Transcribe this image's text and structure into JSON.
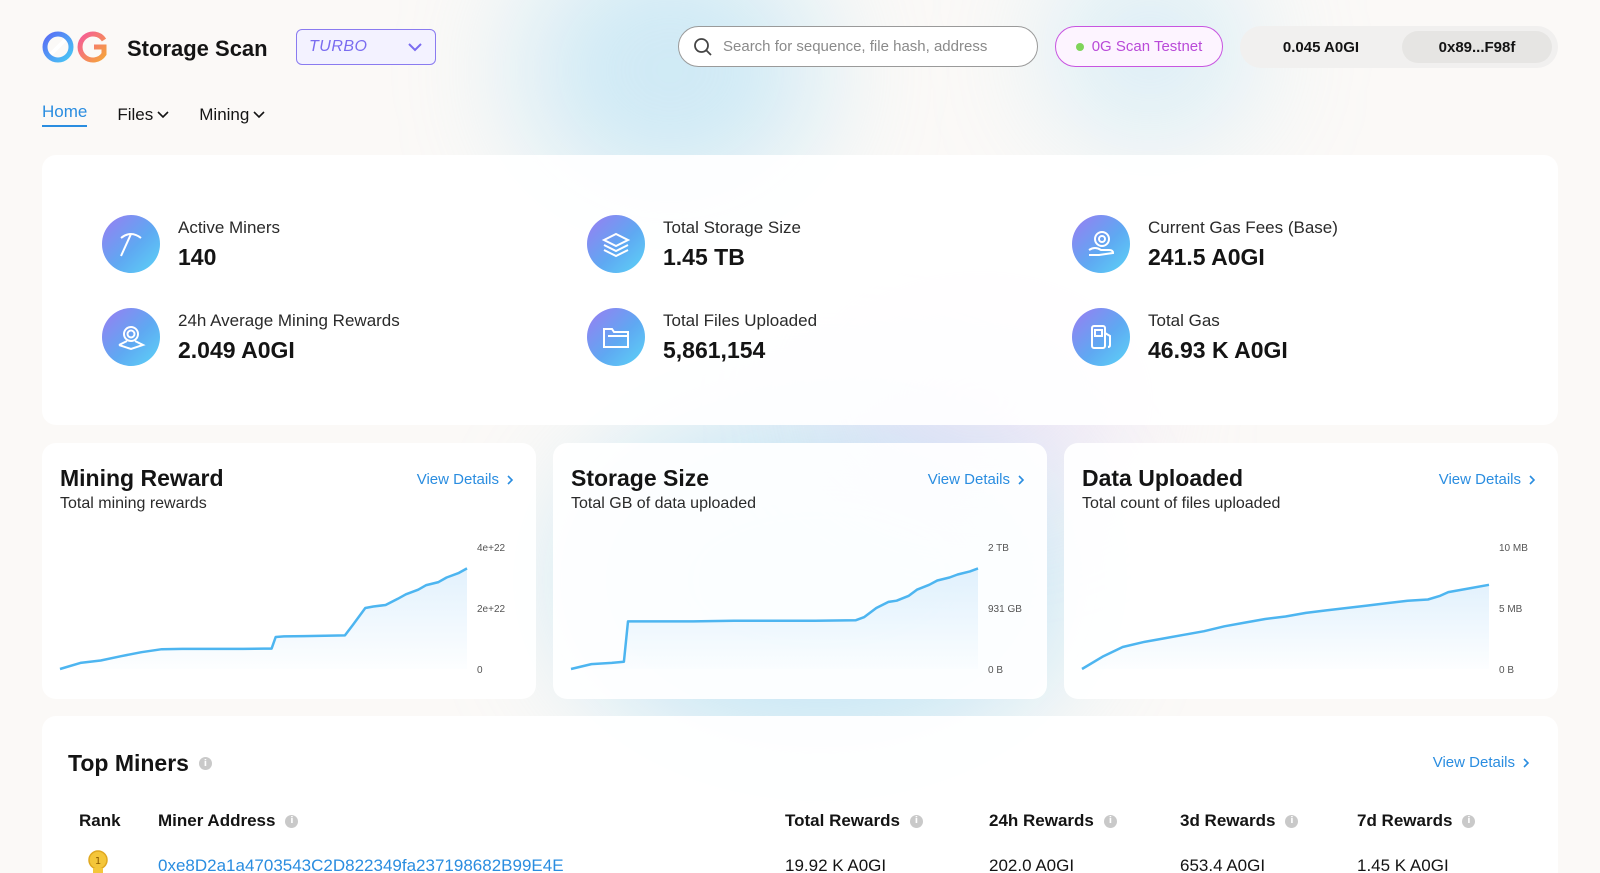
{
  "header": {
    "brand": "Storage Scan",
    "network_select": "TURBO",
    "search_placeholder": "Search for sequence, file hash, address",
    "testnet_label": "0G Scan Testnet",
    "wallet_balance": "0.045 A0GI",
    "wallet_address": "0x89...F98f"
  },
  "nav": {
    "items": [
      {
        "label": "Home"
      },
      {
        "label": "Files"
      },
      {
        "label": "Mining"
      }
    ]
  },
  "stats": [
    {
      "label": "Active Miners",
      "value": "140",
      "icon": "pickaxe-icon"
    },
    {
      "label": "Total Storage Size",
      "value": "1.45 TB",
      "icon": "layers-icon"
    },
    {
      "label": "Current Gas Fees (Base)",
      "value": "241.5 A0GI",
      "icon": "hand-coin-icon"
    },
    {
      "label": "24h Average Mining Rewards",
      "value": "2.049 A0GI",
      "icon": "coin-stack-icon"
    },
    {
      "label": "Total Files Uploaded",
      "value": "5,861,154",
      "icon": "folder-icon"
    },
    {
      "label": "Total Gas",
      "value": "46.93 K A0GI",
      "icon": "fuel-pump-icon"
    }
  ],
  "charts": [
    {
      "title": "Mining Reward",
      "subtitle": "Total mining rewards",
      "link": "View Details",
      "yticks": [
        "4e+22",
        "2e+22",
        "0"
      ]
    },
    {
      "title": "Storage Size",
      "subtitle": "Total GB of data uploaded",
      "link": "View Details",
      "yticks": [
        "2 TB",
        "931 GB",
        "0 B"
      ]
    },
    {
      "title": "Data Uploaded",
      "subtitle": "Total count of files uploaded",
      "link": "View Details",
      "yticks": [
        "10 MB",
        "5 MB",
        "0 B"
      ]
    }
  ],
  "chart_data": [
    {
      "type": "area",
      "title": "Mining Reward",
      "subtitle": "Total mining rewards",
      "ylim": [
        0,
        4e+22
      ],
      "x": [
        0,
        5,
        10,
        15,
        20,
        25,
        30,
        35,
        40,
        45,
        50,
        52,
        53,
        55,
        60,
        65,
        70,
        72,
        75,
        77,
        80,
        83,
        85,
        88,
        90,
        93,
        95,
        98,
        100
      ],
      "series": [
        {
          "values": [
            0,
            2e+21,
            2.8e+21,
            4.2e+21,
            5.5e+21,
            6.5e+21,
            6.6e+21,
            6.6e+21,
            6.6e+21,
            6.6e+21,
            6.7e+21,
            6.7e+21,
            1.05e+22,
            1.07e+22,
            1.08e+22,
            1.09e+22,
            1.1e+22,
            1.45e+22,
            2e+22,
            2.05e+22,
            2.1e+22,
            2.3e+22,
            2.45e+22,
            2.6e+22,
            2.75e+22,
            2.85e+22,
            3e+22,
            3.15e+22,
            3.3e+22
          ]
        }
      ],
      "grid": false
    },
    {
      "type": "area",
      "title": "Storage Size",
      "subtitle": "Total GB of data uploaded",
      "ylim": [
        0,
        2.0
      ],
      "x": [
        0,
        5,
        10,
        13,
        14,
        20,
        30,
        40,
        50,
        60,
        70,
        72,
        75,
        78,
        80,
        83,
        85,
        88,
        90,
        93,
        95,
        98,
        100
      ],
      "series": [
        {
          "values": [
            0,
            0.08,
            0.1,
            0.12,
            0.78,
            0.78,
            0.78,
            0.79,
            0.79,
            0.79,
            0.8,
            0.85,
            1.0,
            1.1,
            1.12,
            1.2,
            1.3,
            1.38,
            1.45,
            1.5,
            1.55,
            1.6,
            1.65
          ]
        }
      ],
      "grid": false
    },
    {
      "type": "area",
      "title": "Data Uploaded",
      "subtitle": "Total count of files uploaded",
      "ylim": [
        0,
        10
      ],
      "x": [
        0,
        5,
        10,
        15,
        20,
        25,
        30,
        35,
        40,
        45,
        50,
        55,
        60,
        65,
        70,
        75,
        80,
        85,
        88,
        90,
        95,
        100
      ],
      "series": [
        {
          "values": [
            0,
            1.0,
            1.8,
            2.2,
            2.5,
            2.8,
            3.1,
            3.5,
            3.8,
            4.1,
            4.3,
            4.6,
            4.8,
            5.0,
            5.2,
            5.4,
            5.6,
            5.7,
            6.0,
            6.3,
            6.6,
            6.9
          ]
        }
      ],
      "grid": false
    }
  ],
  "miners": {
    "title": "Top Miners",
    "link": "View Details",
    "columns": [
      "Rank",
      "Miner Address",
      "Total Rewards",
      "24h Rewards",
      "3d Rewards",
      "7d Rewards"
    ],
    "rows": [
      {
        "rank": "1",
        "address": "0xe8D2a1a4703543C2D822349fa237198682B99E4E",
        "total": "19.92 K A0GI",
        "day": "202.0 A0GI",
        "three_day": "653.4 A0GI",
        "week": "1.45 K A0GI"
      }
    ]
  },
  "colors": {
    "accent": "#2a8de0",
    "testnet": "#b94ad8",
    "select": "#7a6cf0",
    "chart_line": "#4db5f0"
  }
}
